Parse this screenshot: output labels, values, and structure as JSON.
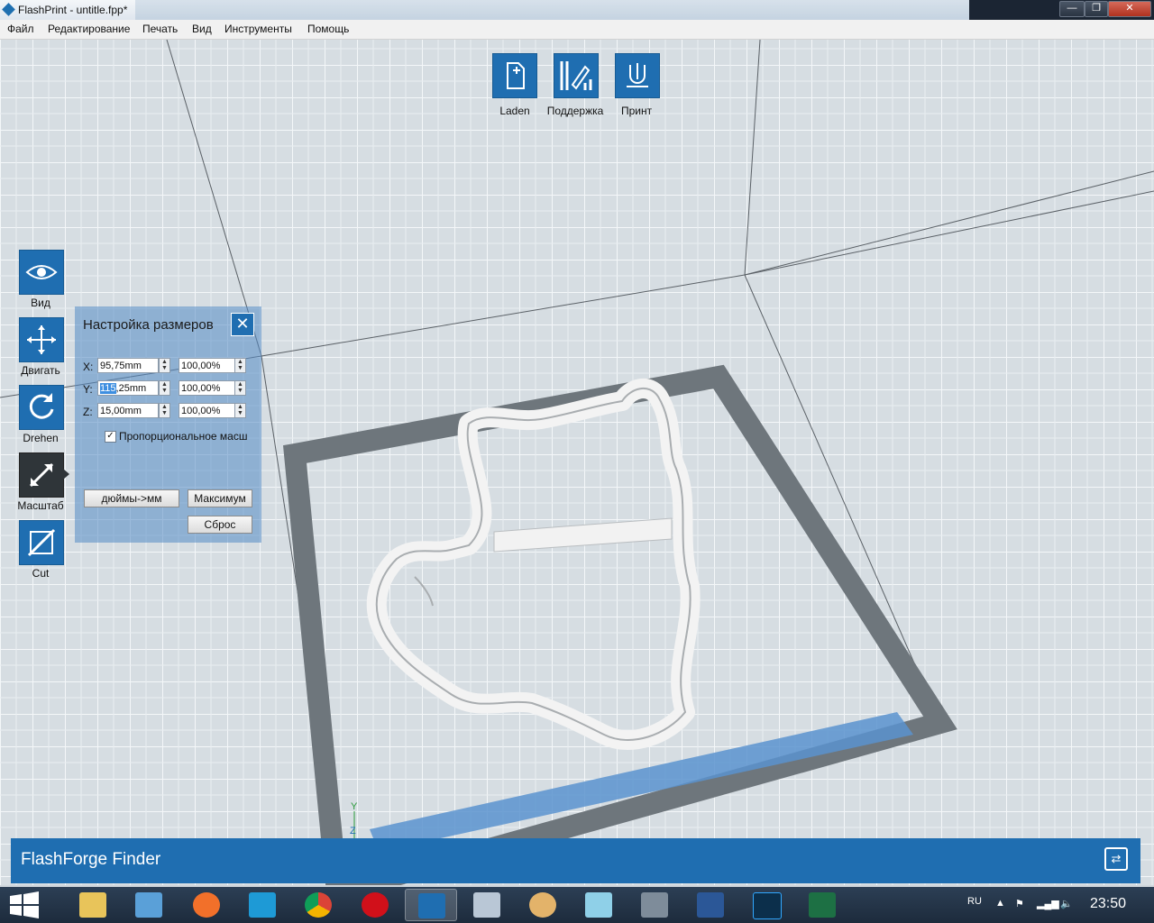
{
  "window": {
    "title": "FlashPrint - untitle.fpp*",
    "controls": [
      "—",
      "❐",
      "✕"
    ]
  },
  "menu": [
    "Файл",
    "Редактирование",
    "Печать",
    "Вид",
    "Инструменты",
    "Помощь"
  ],
  "toolbar_top": [
    {
      "label": "Laden",
      "icon": "load-file-icon"
    },
    {
      "label": "Поддержка",
      "icon": "support-icon"
    },
    {
      "label": "Принт",
      "icon": "print-icon"
    }
  ],
  "toolbar_left": [
    {
      "label": "Вид",
      "icon": "eye-icon"
    },
    {
      "label": "Двигать",
      "icon": "move-arrows-icon"
    },
    {
      "label": "Drehen",
      "icon": "rotate-icon"
    },
    {
      "label": "Масштаб",
      "icon": "scale-icon",
      "active": true
    },
    {
      "label": "Cut",
      "icon": "cut-icon"
    }
  ],
  "scale_dialog": {
    "title": "Настройка размеров",
    "rows": [
      {
        "axis": "X:",
        "size": "95,75mm",
        "percent": "100,00%"
      },
      {
        "axis": "Y:",
        "size": "115,25mm",
        "percent": "100,00%",
        "selected_part": "115"
      },
      {
        "axis": "Z:",
        "size": "15,00mm",
        "percent": "100,00%"
      }
    ],
    "proportional_label": "Пропорциональное масш",
    "proportional_checked": true,
    "inch_button": "дюймы->мм",
    "max_button": "Максимум",
    "reset_button": "Сброс"
  },
  "axis_labels": {
    "y": "Y",
    "z": "Z"
  },
  "status_bar": {
    "title": "FlashForge Finder"
  },
  "taskbar": {
    "language": "RU",
    "time": "23:50",
    "apps": [
      "file-explorer",
      "media-player",
      "origin",
      "ccleaner",
      "chrome",
      "opera",
      "flashprint",
      "calculator",
      "paint",
      "notepad",
      "remote-desktop",
      "word",
      "photoshop",
      "excel"
    ]
  },
  "colors": {
    "accent": "#1f6eb1",
    "active_tool": "#2f3539",
    "build_plate_frame": "#6e767c"
  }
}
